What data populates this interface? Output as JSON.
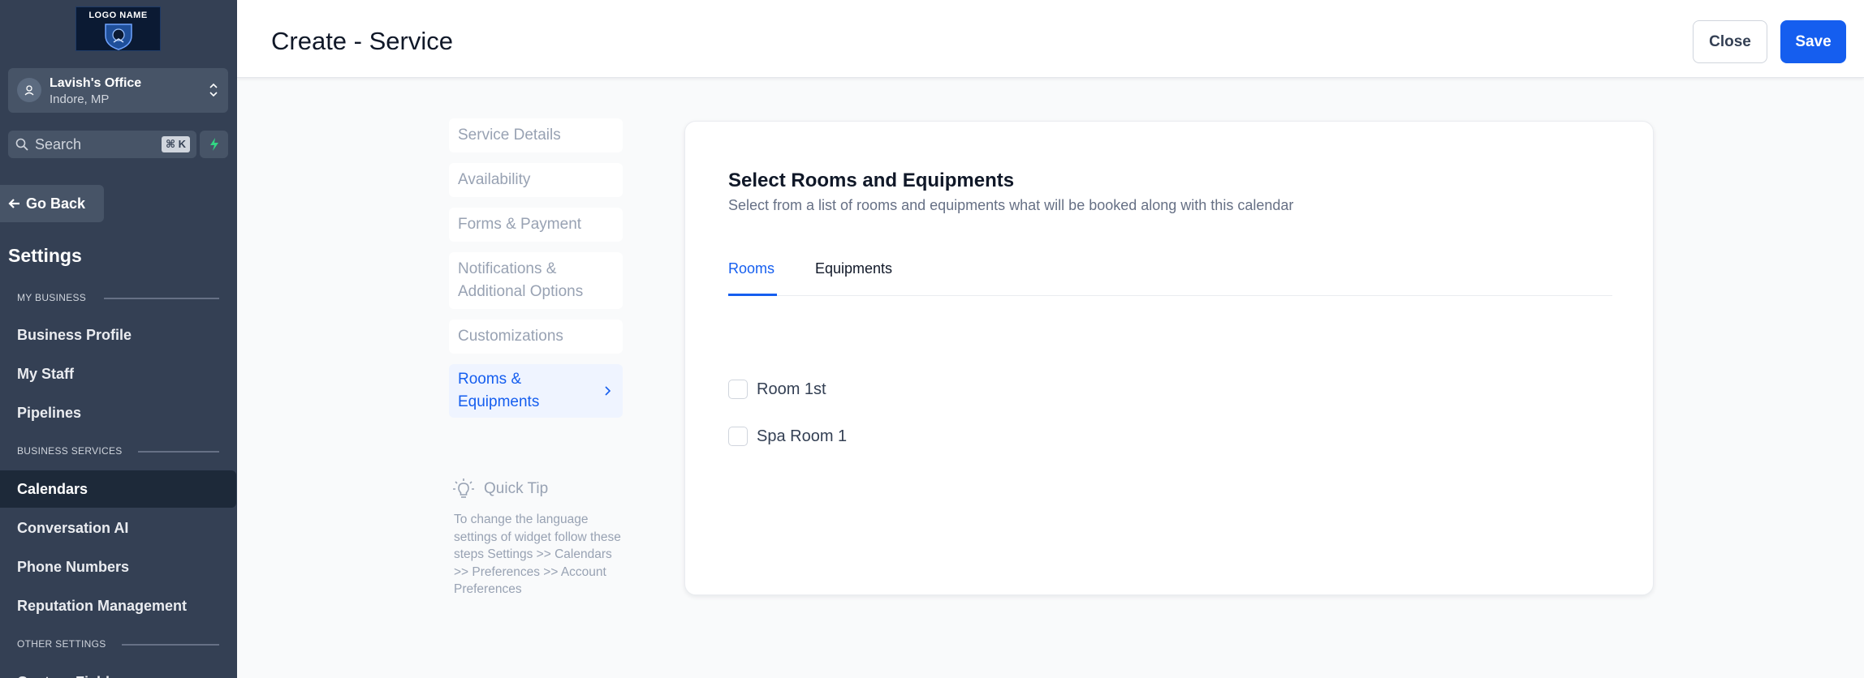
{
  "sidebar": {
    "logo_text": "LOGO NAME",
    "location": {
      "name": "Lavish's Office",
      "sub": "Indore, MP"
    },
    "search": {
      "placeholder": "Search",
      "shortcut": "⌘ K"
    },
    "go_back": "Go Back",
    "title": "Settings",
    "sections": [
      {
        "label": "MY BUSINESS",
        "items": [
          "Business Profile",
          "My Staff",
          "Pipelines"
        ]
      },
      {
        "label": "BUSINESS SERVICES",
        "items": [
          "Calendars",
          "Conversation AI",
          "Phone Numbers",
          "Reputation Management"
        ]
      },
      {
        "label": "OTHER SETTINGS",
        "items": [
          "Custom Fields"
        ]
      }
    ],
    "active_item": "Calendars"
  },
  "header": {
    "title": "Create - Service",
    "close_label": "Close",
    "save_label": "Save"
  },
  "steps": [
    {
      "label": "Service Details"
    },
    {
      "label": "Availability"
    },
    {
      "label": "Forms & Payment"
    },
    {
      "label": "Notifications & Additional Options"
    },
    {
      "label": "Customizations"
    },
    {
      "label": "Rooms & Equipments"
    }
  ],
  "active_step": "Rooms & Equipments",
  "quick_tip": {
    "title": "Quick Tip",
    "text": "To change the language settings of widget follow these steps Settings >> Calendars >> Preferences >> Account Preferences"
  },
  "card": {
    "title": "Select Rooms and Equipments",
    "subtitle": "Select from a list of rooms and equipments what will be booked along with this calendar",
    "tabs": [
      {
        "label": "Rooms"
      },
      {
        "label": "Equipments"
      }
    ],
    "active_tab": "Rooms",
    "rooms": [
      {
        "label": "Room 1st",
        "checked": false
      },
      {
        "label": "Spa Room 1",
        "checked": false
      }
    ]
  },
  "colors": {
    "sidebar_bg": "#344054",
    "primary": "#155eef",
    "active_nav_bg": "#1d2939"
  }
}
